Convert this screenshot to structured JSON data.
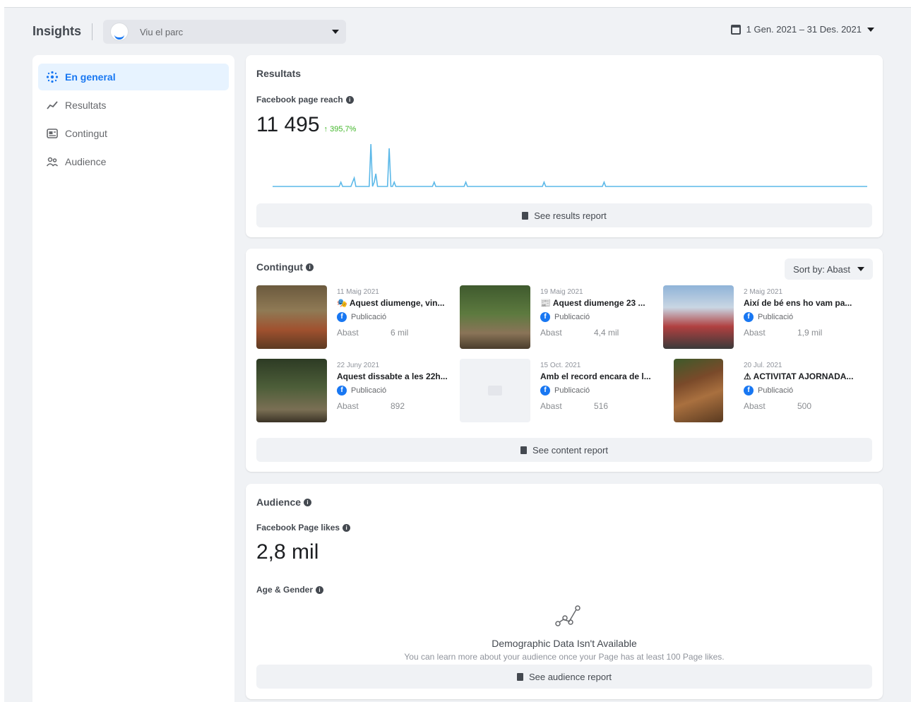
{
  "header": {
    "title": "Insights",
    "page_name": "Viu el parc",
    "date_range": "1 Gen. 2021 – 31 Des. 2021"
  },
  "sidebar": {
    "items": [
      {
        "label": "En general",
        "icon": "overview-icon",
        "active": true
      },
      {
        "label": "Resultats",
        "icon": "results-chart-icon",
        "active": false
      },
      {
        "label": "Contingut",
        "icon": "content-icon",
        "active": false
      },
      {
        "label": "Audience",
        "icon": "audience-icon",
        "active": false
      }
    ]
  },
  "results": {
    "title": "Resultats",
    "metric_label": "Facebook page reach",
    "value": "11 495",
    "change": "↑ 395,7%",
    "button": "See results report",
    "sparkline": [
      0,
      0,
      0,
      0,
      0,
      0,
      0,
      0,
      0,
      0,
      0,
      0,
      0,
      0,
      0,
      0,
      0,
      0,
      0,
      0,
      0,
      0,
      0,
      0,
      0,
      0,
      0,
      0,
      0,
      0,
      0,
      0,
      0,
      0,
      0,
      0,
      0,
      0,
      0,
      0,
      0,
      1,
      0,
      0,
      0,
      0,
      0,
      0,
      1,
      2,
      0,
      0,
      0,
      0,
      0,
      0,
      0,
      0,
      0,
      10,
      0,
      1,
      3,
      0,
      0,
      0,
      0,
      0,
      0,
      0,
      9,
      0,
      0,
      1,
      0,
      0,
      0,
      0,
      0,
      0,
      0,
      0,
      0,
      0,
      0,
      0,
      0,
      0,
      0,
      0,
      0,
      0,
      0,
      0,
      0,
      0,
      0,
      1,
      0,
      0,
      0,
      0,
      0,
      0,
      0,
      0,
      0,
      0,
      0,
      0,
      0,
      0,
      0,
      0,
      0,
      0,
      1,
      0,
      0,
      0,
      0,
      0,
      0,
      0,
      0,
      0,
      0,
      0,
      0,
      0,
      0,
      0,
      0,
      0,
      0,
      0,
      0,
      0,
      0,
      0,
      0,
      0,
      0,
      0,
      0,
      0,
      0,
      0,
      0,
      0,
      0,
      0,
      0,
      0,
      0,
      0,
      0,
      0,
      0,
      0,
      0,
      0,
      0,
      1,
      0,
      0,
      0,
      0,
      0,
      0,
      0,
      0,
      0,
      0,
      0,
      0,
      0,
      0,
      0,
      0,
      0,
      0,
      0,
      0,
      0,
      0,
      0,
      0,
      0,
      0,
      0,
      0,
      0,
      0,
      0,
      0,
      0,
      0,
      0,
      1,
      0,
      0,
      0,
      0,
      0,
      0,
      0,
      0,
      0,
      0,
      0,
      0,
      0,
      0,
      0,
      0,
      0,
      0,
      0,
      0,
      0,
      0,
      0,
      0,
      0,
      0,
      0,
      0,
      0,
      0,
      0,
      0,
      0,
      0,
      0,
      0,
      0,
      0,
      0,
      0,
      0,
      0,
      0,
      0,
      0,
      0,
      0,
      0,
      0,
      0,
      0,
      0,
      0,
      0,
      0,
      0,
      0,
      0,
      0,
      0,
      0,
      0,
      0,
      0,
      0,
      0,
      0,
      0,
      0,
      0,
      0,
      0,
      0,
      0,
      0,
      0,
      0,
      0,
      0,
      0,
      0,
      0,
      0,
      0,
      0,
      0,
      0,
      0,
      0,
      0,
      0,
      0,
      0,
      0,
      0,
      0,
      0,
      0,
      0,
      0,
      0,
      0,
      0,
      0,
      0,
      0,
      0,
      0,
      0,
      0,
      0,
      0,
      0,
      0,
      0,
      0,
      0,
      0,
      0,
      0,
      0,
      0,
      0,
      0,
      0,
      0,
      0,
      0,
      0,
      0,
      0,
      0,
      0,
      0,
      0,
      0,
      0,
      0,
      0,
      0,
      0,
      0,
      0,
      0,
      0,
      0,
      0,
      0,
      0,
      0,
      0,
      0,
      0,
      0,
      0,
      0,
      0,
      0
    ]
  },
  "content": {
    "title": "Contingut",
    "sort_label": "Sort by: Abast",
    "button": "See content report",
    "posts": [
      {
        "date": "11 Maig 2021",
        "title": "🎭 Aquest diumenge, vin...",
        "type": "Publicació",
        "metric_label": "Abast",
        "metric_value": "6 mil",
        "thumb": "photo"
      },
      {
        "date": "19 Maig 2021",
        "title": "📰 Aquest diumenge 23 ...",
        "type": "Publicació",
        "metric_label": "Abast",
        "metric_value": "4,4 mil",
        "thumb": "photo"
      },
      {
        "date": "2 Maig 2021",
        "title": "Així de bé ens ho vam pa...",
        "type": "Publicació",
        "metric_label": "Abast",
        "metric_value": "1,9 mil",
        "thumb": "photo"
      },
      {
        "date": "22 Juny 2021",
        "title": "Aquest dissabte a les 22h...",
        "type": "Publicació",
        "metric_label": "Abast",
        "metric_value": "892",
        "thumb": "photo"
      },
      {
        "date": "15 Oct. 2021",
        "title": "Amb el record encara de l...",
        "type": "Publicació",
        "metric_label": "Abast",
        "metric_value": "516",
        "thumb": "placeholder"
      },
      {
        "date": "20 Jul. 2021",
        "title": "⚠ ACTIVITAT AJORNADA...",
        "type": "Publicació",
        "metric_label": "Abast",
        "metric_value": "500",
        "thumb": "photo"
      }
    ]
  },
  "audience": {
    "title": "Audience",
    "likes_label": "Facebook Page likes",
    "likes_value": "2,8 mil",
    "age_gender_label": "Age & Gender",
    "empty_title": "Demographic Data Isn't Available",
    "empty_sub": "You can learn more about your audience once your Page has at least 100 Page likes.",
    "button": "See audience report"
  },
  "colors": {
    "accent": "#1877f2",
    "sparkline": "#5bb8e8",
    "growth": "#42b72a"
  }
}
